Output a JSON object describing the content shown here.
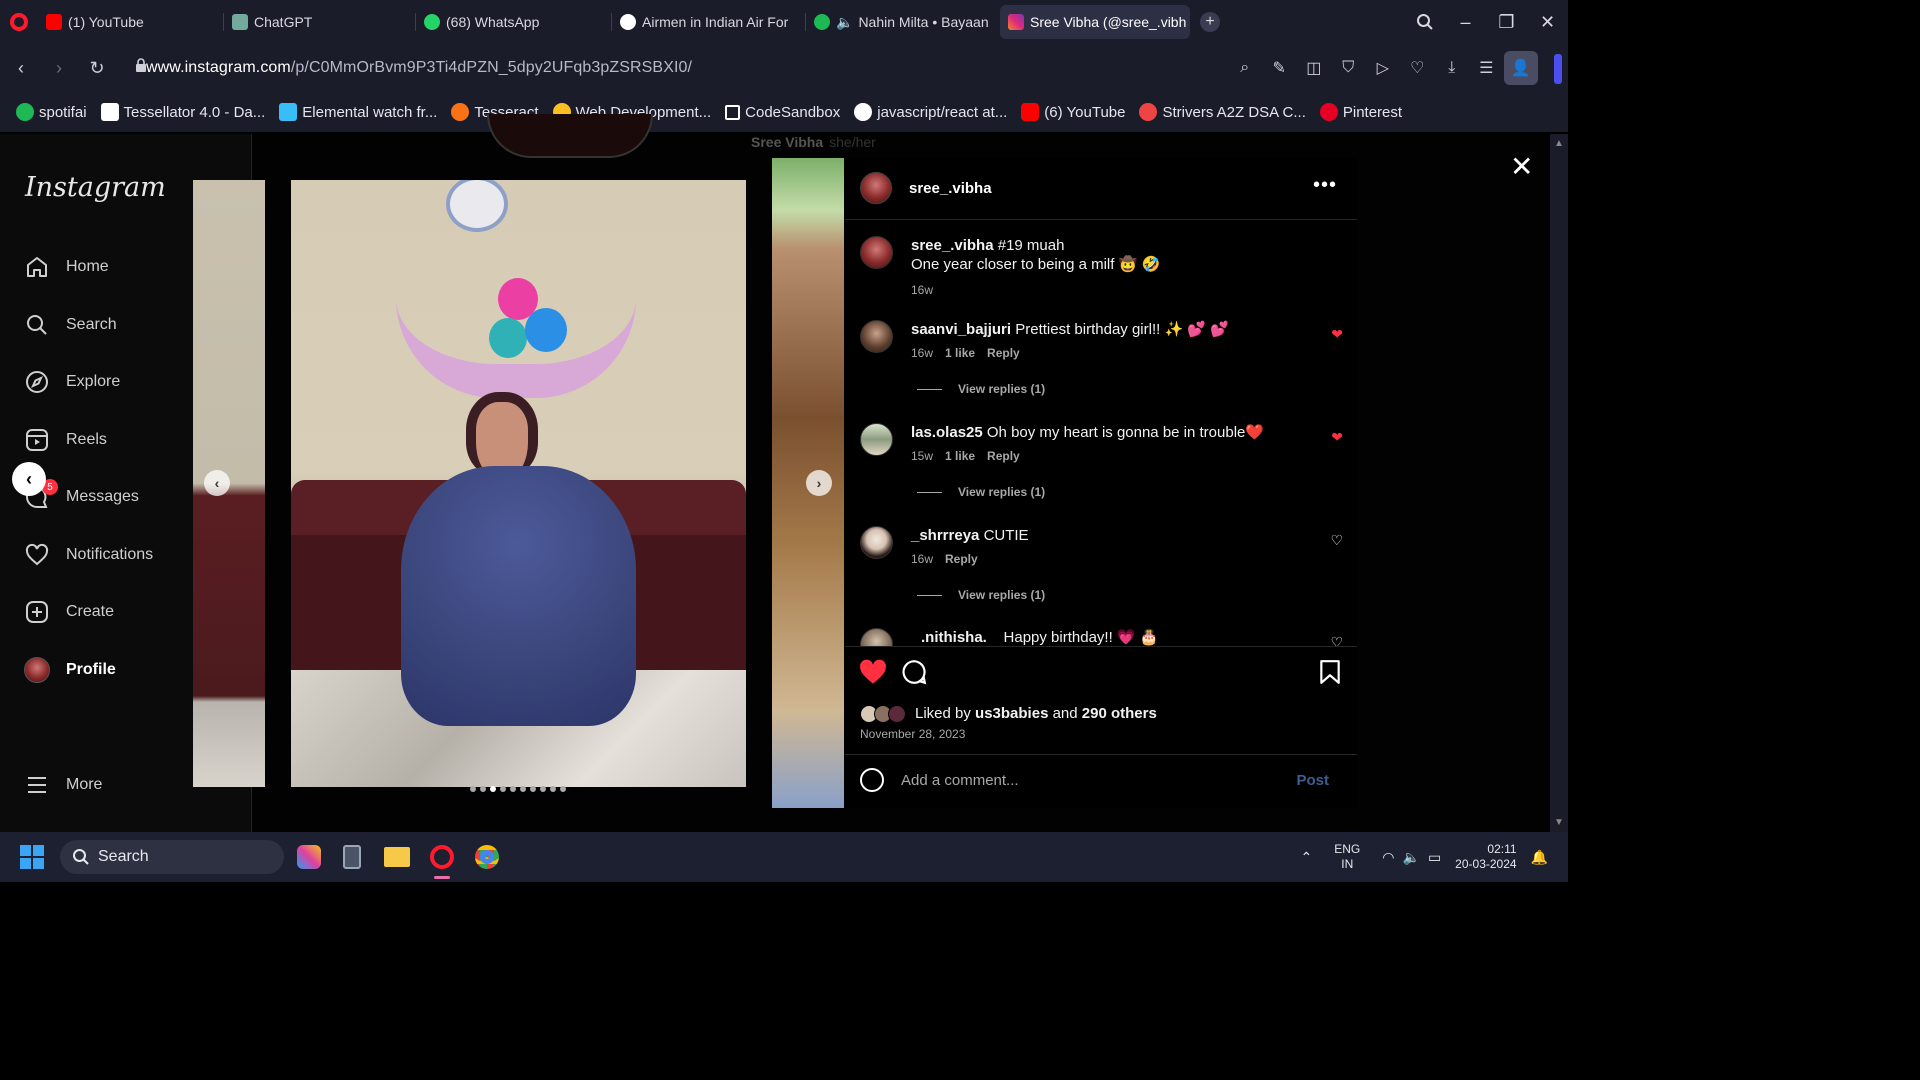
{
  "browser": {
    "tabs": [
      {
        "label": "(1) YouTube",
        "color": "#ff0000"
      },
      {
        "label": "ChatGPT",
        "color": "#74aa9c"
      },
      {
        "label": "(68) WhatsApp",
        "color": "#25d366"
      },
      {
        "label": "Airmen in Indian Air For",
        "color": "#ffffff"
      },
      {
        "label": "Nahin Milta • Bayaan",
        "color": "#1db954"
      },
      {
        "label": "Sree Vibha (@sree_.vibh",
        "color": "#e1306c"
      }
    ],
    "url_domain": "www.instagram.com",
    "url_path": "/p/C0MmOrBvm9P3Ti4dPZN_5dpy2UFqb3pZSRSBXI0/",
    "bookmarks": [
      {
        "label": "spotifai",
        "color": "#1db954"
      },
      {
        "label": "Tessellator 4.0 - Da...",
        "color": "#ffffff"
      },
      {
        "label": "Elemental watch fr...",
        "color": "#38bdf8"
      },
      {
        "label": "Tesseract",
        "color": "#f97316"
      },
      {
        "label": "Web Development...",
        "color": "#fbbf24"
      },
      {
        "label": "CodeSandbox",
        "color": "#ffffff"
      },
      {
        "label": "javascript/react at...",
        "color": "#ffffff"
      },
      {
        "label": "(6) YouTube",
        "color": "#ff0000"
      },
      {
        "label": "Strivers A2Z DSA C...",
        "color": "#ef4444"
      },
      {
        "label": "Pinterest",
        "color": "#e60023"
      }
    ]
  },
  "instagram": {
    "logo": "Instagram",
    "nav": [
      {
        "label": "Home",
        "icon": "home-icon"
      },
      {
        "label": "Search",
        "icon": "search-icon"
      },
      {
        "label": "Explore",
        "icon": "compass-icon"
      },
      {
        "label": "Reels",
        "icon": "reels-icon"
      },
      {
        "label": "Messages",
        "icon": "messenger-icon"
      },
      {
        "label": "Notifications",
        "icon": "heart-icon"
      },
      {
        "label": "Create",
        "icon": "plus-square-icon"
      },
      {
        "label": "Profile",
        "icon": "avatar"
      }
    ],
    "more_label": "More",
    "messages_badge": "5",
    "background_name": "Sree Vibha",
    "background_pronouns": "she/her",
    "carousel_dots": 10,
    "active_dot": 2
  },
  "post": {
    "author": "sree_.vibha",
    "caption_user": "sree_.vibha",
    "caption_line1": "#19 muah",
    "caption_line2": "One year closer to being a milf 🤠 🤣",
    "caption_time": "16w",
    "comments": [
      {
        "user": "saanvi_bajjuri",
        "text": "Prettiest birthday girl!! ✨ 💕 💕",
        "time": "16w",
        "likes": "1 like",
        "reply": "Reply",
        "view_replies": "View replies (1)",
        "liked": true
      },
      {
        "user": "las.olas25",
        "text": "Oh boy my heart is gonna be in trouble❤️",
        "time": "15w",
        "likes": "1 like",
        "reply": "Reply",
        "view_replies": "View replies (1)",
        "liked": true
      },
      {
        "user": "_shrrreya",
        "text": "CUTIE",
        "time": "16w",
        "likes": "",
        "reply": "Reply",
        "view_replies": "View replies (1)",
        "liked": false
      },
      {
        "user": ".nithisha.",
        "text": "Happy birthday!! 💗 🎂",
        "time": "",
        "likes": "",
        "reply": "",
        "view_replies": "",
        "liked": false
      }
    ],
    "liked_by_prefix": "Liked by",
    "liked_by_user": "us3babies",
    "liked_by_and": "and",
    "liked_by_others": "290 others",
    "date": "November 28, 2023",
    "comment_placeholder": "Add a comment...",
    "post_button": "Post"
  },
  "taskbar": {
    "search_label": "Search",
    "lang": "ENG",
    "region": "IN",
    "time": "02:11",
    "date": "20-03-2024"
  }
}
